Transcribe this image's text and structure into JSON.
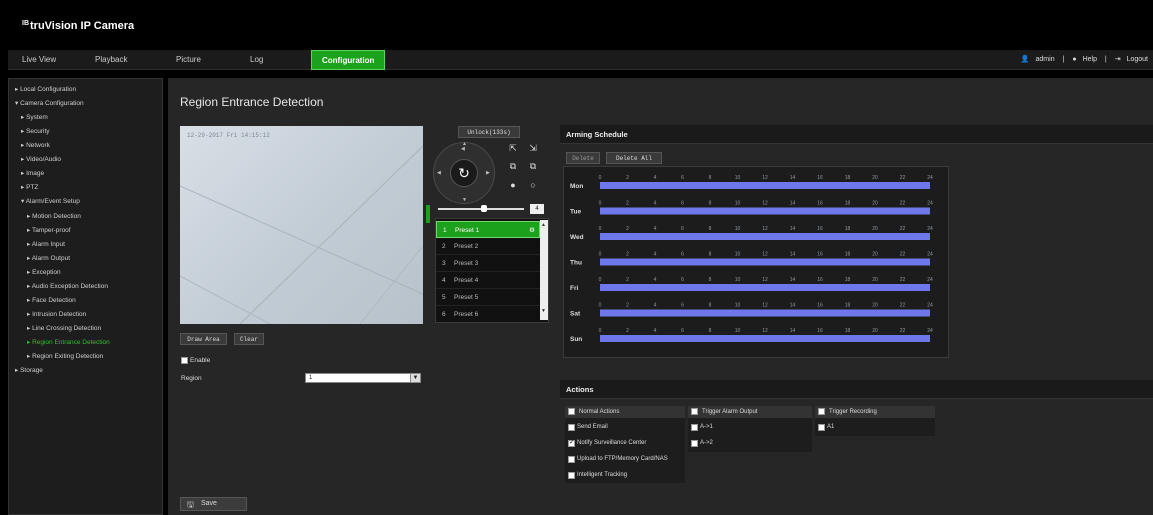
{
  "app": {
    "brand": "truVision IP Camera",
    "brand_mark": "IB"
  },
  "nav": {
    "tabs": [
      "Live View",
      "Playback",
      "Picture",
      "Log",
      "Configuration"
    ],
    "active_tab": "Configuration",
    "user": "admin",
    "help": "Help",
    "logout": "Logout",
    "separator": "|"
  },
  "sidebar": {
    "items": [
      {
        "label": "▸ Local Configuration"
      },
      {
        "label": "▾ Camera Configuration"
      },
      {
        "label": "▸ System"
      },
      {
        "label": "▸ Security"
      },
      {
        "label": "▸ Network"
      },
      {
        "label": "▸ Video/Audio"
      },
      {
        "label": "▸ Image"
      },
      {
        "label": "▸ PTZ"
      },
      {
        "label": "▾ Alarm/Event Setup"
      },
      {
        "label": "▸ Motion Detection"
      },
      {
        "label": "▸ Tamper-proof"
      },
      {
        "label": "▸ Alarm Input"
      },
      {
        "label": "▸ Alarm Output"
      },
      {
        "label": "▸ Exception"
      },
      {
        "label": "▸ Audio Exception Detection"
      },
      {
        "label": "▸ Face Detection"
      },
      {
        "label": "▸ Intrusion Detection"
      },
      {
        "label": "▸ Line Crossing Detection"
      },
      {
        "label": "▸ Region Entrance Detection"
      },
      {
        "label": "▸ Region Exiting Detection"
      },
      {
        "label": "▸ Storage"
      }
    ],
    "active_item": "Region Entrance Detection"
  },
  "main": {
    "title": "Region Entrance Detection",
    "video_timestamp": "12-29-2017 Fri 14:15:12",
    "draw_area_label": "Draw Area",
    "clear_label": "Clear",
    "enable_label": "Enable",
    "enable_checked": false,
    "region_label": "Region",
    "region_value": "1",
    "save_label": "Save"
  },
  "ptz": {
    "unlock_label": "Unlock(133s)",
    "zoom_value": "4",
    "presets": [
      {
        "num": "1",
        "name": "Preset 1"
      },
      {
        "num": "2",
        "name": "Preset 2"
      },
      {
        "num": "3",
        "name": "Preset 3"
      },
      {
        "num": "4",
        "name": "Preset 4"
      },
      {
        "num": "5",
        "name": "Preset 5"
      },
      {
        "num": "6",
        "name": "Preset 6"
      }
    ],
    "selected_preset": "Preset 1"
  },
  "schedule": {
    "title": "Arming Schedule",
    "delete_label": "Delete",
    "delete_all_label": "Delete All",
    "days": [
      "Mon",
      "Tue",
      "Wed",
      "Thu",
      "Fri",
      "Sat",
      "Sun"
    ],
    "hour_ticks": [
      "0",
      "2",
      "4",
      "6",
      "8",
      "10",
      "12",
      "14",
      "16",
      "18",
      "20",
      "22",
      "24"
    ],
    "bar_color": "#6f78ea"
  },
  "actions": {
    "title": "Actions",
    "normal": {
      "header": "Normal Actions",
      "items": [
        {
          "label": "Send Email",
          "checked": false
        },
        {
          "label": "Notify Surveillance Center",
          "checked": true
        },
        {
          "label": "Upload to FTP/Memory Card/NAS",
          "checked": false
        },
        {
          "label": "Intelligent Tracking",
          "checked": false
        }
      ]
    },
    "alarm_output": {
      "header": "Trigger Alarm Output",
      "items": [
        {
          "label": "A->1",
          "checked": false
        },
        {
          "label": "A->2",
          "checked": false
        }
      ]
    },
    "recording": {
      "header": "Trigger Recording",
      "items": [
        {
          "label": "A1",
          "checked": false
        }
      ]
    }
  },
  "colors": {
    "accent": "#1ca11c",
    "background": "#262626",
    "header": "#000000"
  }
}
